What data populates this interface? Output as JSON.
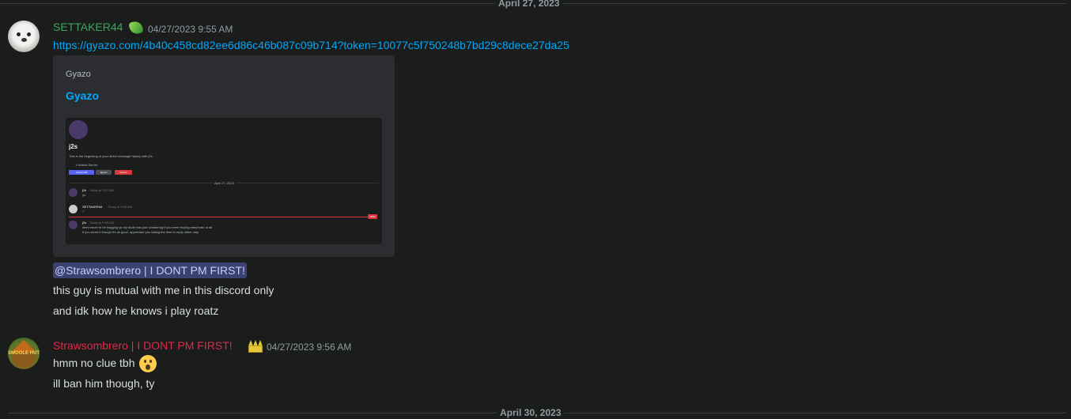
{
  "dividers": {
    "top": "April 27, 2023",
    "bottom": "April 30, 2023"
  },
  "messages": [
    {
      "author": "SETTAKER44",
      "author_color": "#3ba55c",
      "badge_icon": "gem-icon",
      "timestamp": "04/27/2023 9:55 AM",
      "link": "https://gyazo.com/4b40c458cd82ee6d86c46b087c09b714?token=10077c5f750248b7bd29c8dece27da25",
      "embed": {
        "provider": "Gyazo",
        "title": "Gyazo",
        "screenshot": {
          "name": "j2s",
          "intro": "This is the beginning of your direct message history with j2s.",
          "mutual": "1 Mutual Server",
          "buttons": [
            "Accept DM",
            "Ignore",
            "Report"
          ],
          "date": "April 27, 2023",
          "new_tag": "NEW",
          "rows": [
            {
              "author": "j2s",
              "time": "Today at 9:07 AM",
              "text": "yo"
            },
            {
              "author": "SETTAKER44",
              "time": "Today at 9:55 AM",
              "text": "?"
            },
            {
              "author": "j2s",
              "time": "Today at 9:55 AM",
              "text": "didnt mean to be bugging ya my dude was just wondering if you were buying read/roatz at all",
              "text2": "if you weren't though it's all good, appreciate you taking the time to reply either way"
            }
          ]
        }
      },
      "lines": [
        {
          "mention": "@Strawsombrero | I DONT PM FIRST!"
        },
        {
          "text": "this guy is mutual with me in this discord only"
        },
        {
          "text": "and idk how he knows i play roatz"
        }
      ]
    },
    {
      "author": "Strawsombrero | I DONT PM FIRST!",
      "author_color": "#e0294b",
      "badge_icon": "crown-icon",
      "timestamp": "04/27/2023 9:56 AM",
      "avatar_text": "SMOOLE HUT",
      "lines": [
        {
          "text": "hmm no clue tbh",
          "emoji": "hushed-face-emoji"
        },
        {
          "text": "ill ban him though, ty"
        }
      ]
    }
  ]
}
